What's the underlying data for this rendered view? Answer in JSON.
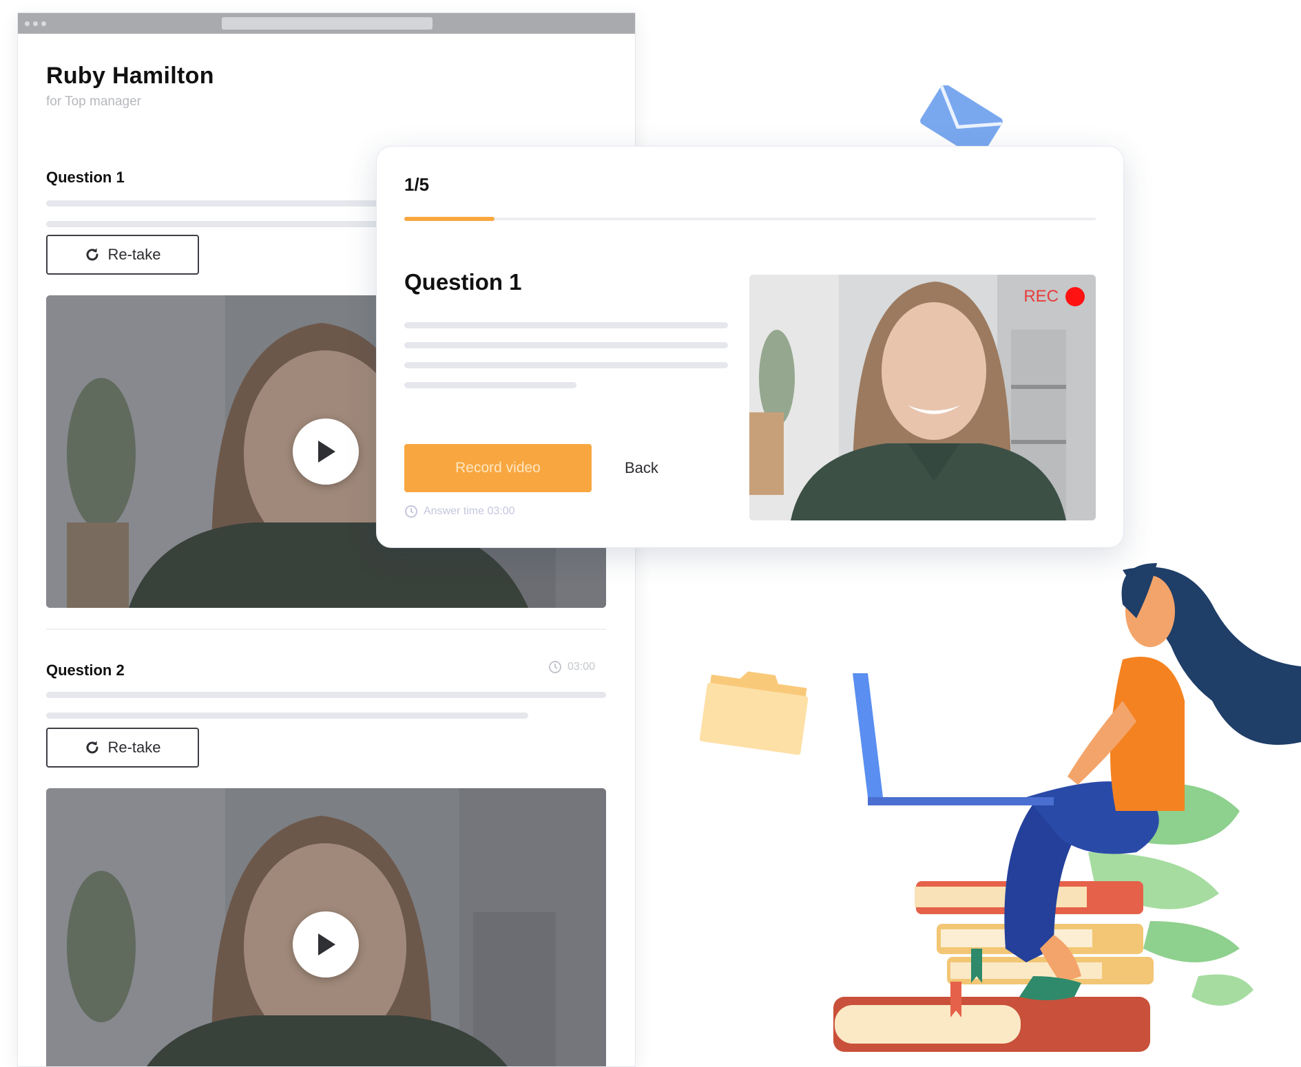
{
  "review": {
    "candidate_name": "Ruby Hamilton",
    "candidate_role": "for Top manager",
    "questions": [
      {
        "title": "Question 1",
        "retake_label": "Re-take"
      },
      {
        "title": "Question 2",
        "retake_label": "Re-take",
        "timer": "03:00"
      }
    ]
  },
  "recorder": {
    "step": "1/5",
    "progress_fraction": 0.13,
    "question_title": "Question 1",
    "record_label": "Record video",
    "back_label": "Back",
    "answer_time": "Answer time 03:00",
    "rec_label": "REC"
  },
  "colors": {
    "accent": "#f8a740",
    "rec_red": "#ff1212"
  },
  "icons": [
    "window-dots-icon",
    "retake-icon",
    "play-icon",
    "clock-icon",
    "rec-dot-icon",
    "envelope-icon",
    "folder-icon",
    "woman-with-laptop-illustration",
    "books-illustration"
  ]
}
